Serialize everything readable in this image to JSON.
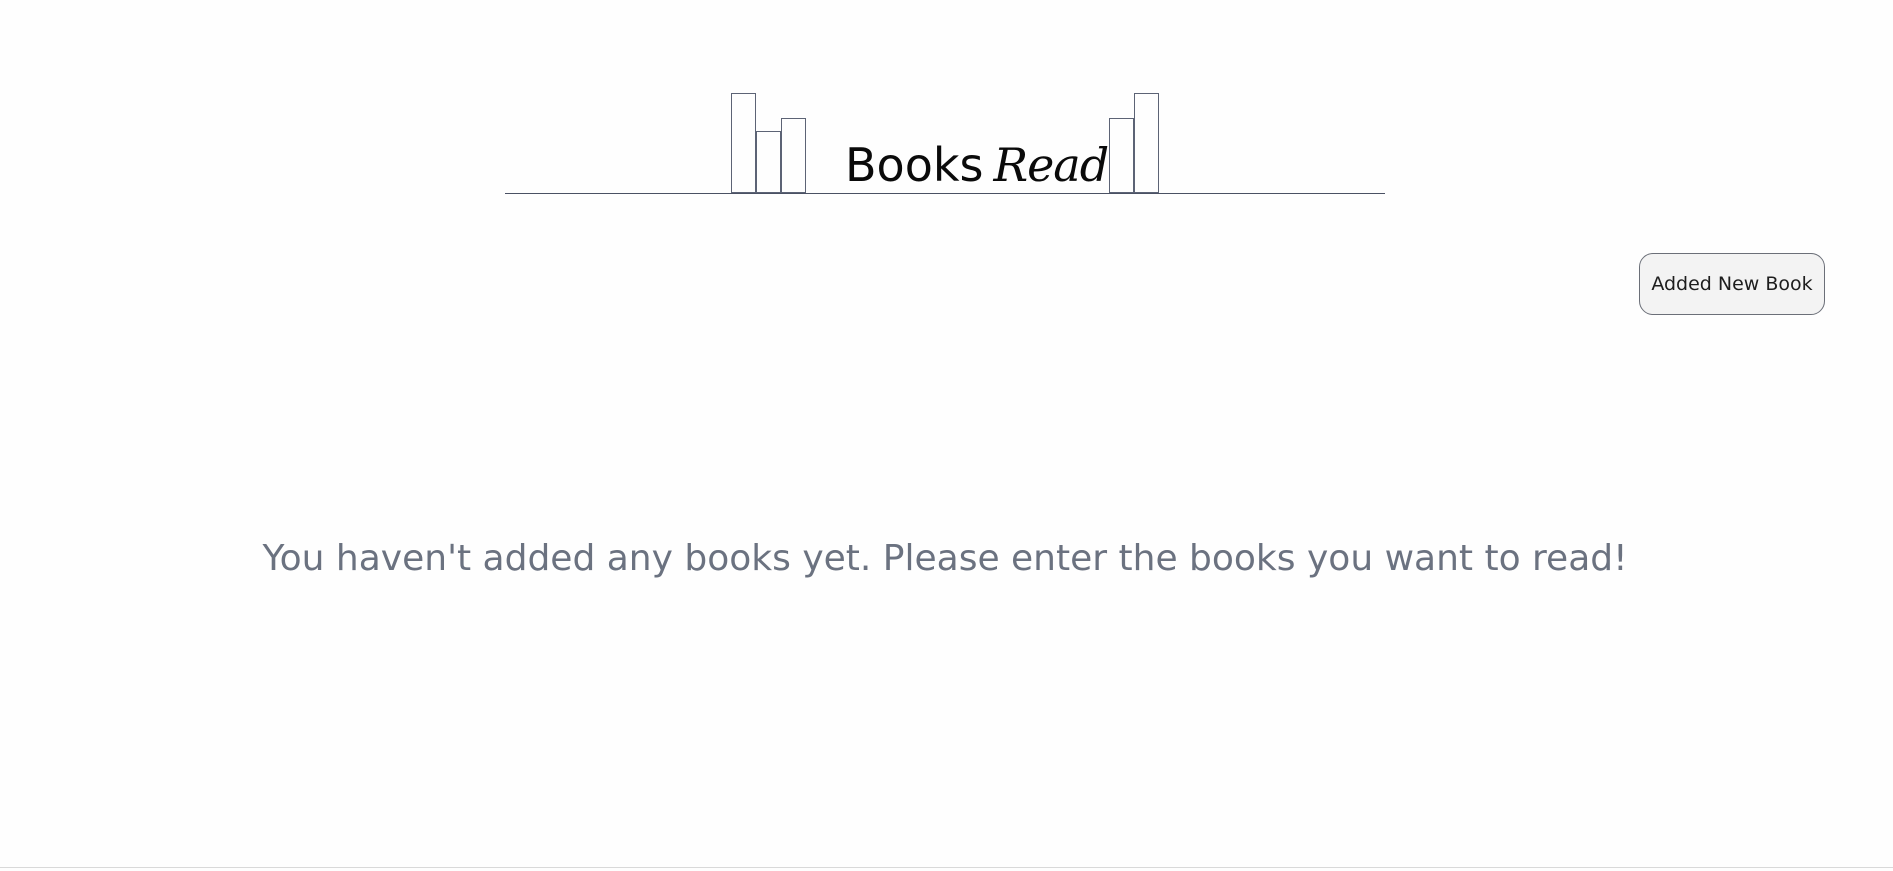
{
  "header": {
    "title_word": "Books",
    "title_script": "Read"
  },
  "actions": {
    "add_book_label": "Added New Book"
  },
  "main": {
    "empty_message": "You haven't added any books yet. Please enter the books you want to read!"
  },
  "colors": {
    "shelf_line": "#4a5163",
    "book_outline": "#5c6375",
    "message_text": "#6b7280",
    "button_background": "#f3f3f3",
    "button_border": "#6b6f78"
  }
}
